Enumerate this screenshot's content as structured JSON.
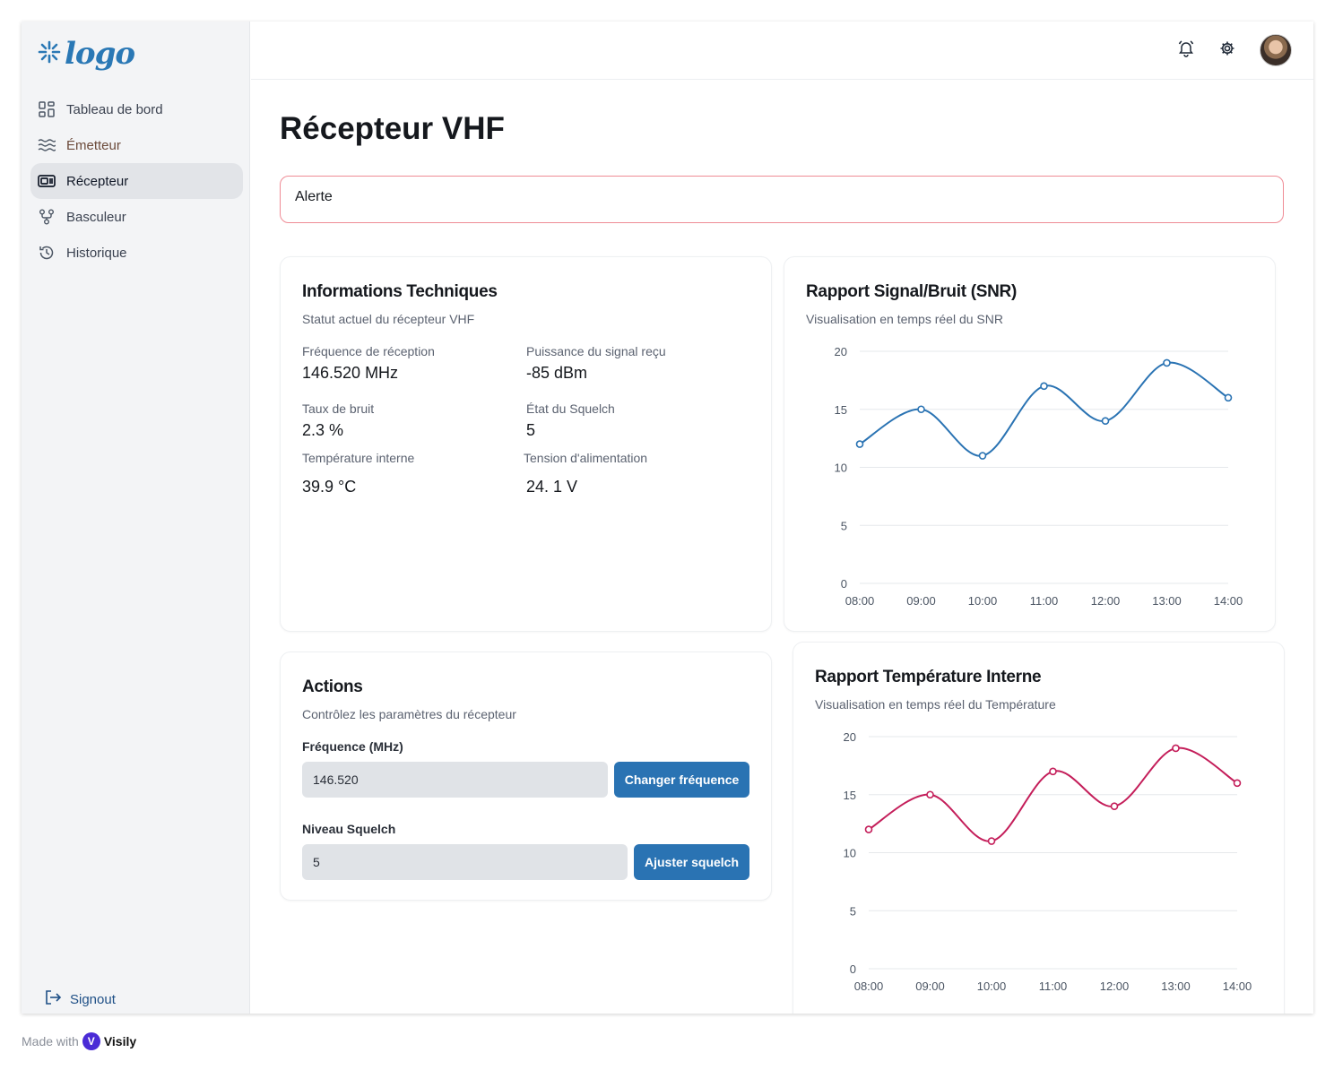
{
  "logo": {
    "text": "logo"
  },
  "sidebar": {
    "items": [
      {
        "label": "Tableau de bord",
        "icon": "dashboard-icon"
      },
      {
        "label": "Émetteur",
        "icon": "waves-icon"
      },
      {
        "label": "Récepteur",
        "icon": "receiver-icon",
        "active": true
      },
      {
        "label": "Basculeur",
        "icon": "switch-icon"
      },
      {
        "label": "Historique",
        "icon": "history-icon"
      }
    ],
    "signout": "Signout"
  },
  "header": {
    "icons": [
      "bell-icon",
      "gear-icon",
      "avatar"
    ]
  },
  "page": {
    "title": "Récepteur VHF",
    "alert": "Alerte"
  },
  "info": {
    "title": "Informations Techniques",
    "subtitle": "Statut actuel du récepteur VHF",
    "items": [
      {
        "label": "Fréquence de réception",
        "value": "146.520 MHz"
      },
      {
        "label": "Puissance du signal reçu",
        "value": "-85 dBm"
      },
      {
        "label": "Taux de bruit",
        "value": "2.3 %"
      },
      {
        "label": "État du Squelch",
        "value": "5"
      },
      {
        "label": "Température interne",
        "value": "39.9 °C"
      },
      {
        "label": "Tension d'alimentation",
        "value": "24. 1 V"
      }
    ]
  },
  "actions": {
    "title": "Actions",
    "subtitle": "Contrôlez les paramètres du récepteur",
    "freq_label": "Fréquence (MHz)",
    "freq_value": "146.520",
    "freq_button": "Changer fréquence",
    "squelch_label": "Niveau Squelch",
    "squelch_value": "5",
    "squelch_button": "Ajuster squelch"
  },
  "chart_data": [
    {
      "type": "line",
      "title": "Rapport Signal/Bruit (SNR)",
      "subtitle": "Visualisation en temps réel du SNR",
      "x": [
        "08:00",
        "09:00",
        "10:00",
        "11:00",
        "12:00",
        "13:00",
        "14:00"
      ],
      "series": [
        {
          "values": [
            12,
            15,
            11,
            17,
            14,
            19,
            16
          ]
        }
      ],
      "ylim": [
        0,
        20
      ],
      "yticks": [
        0,
        5,
        10,
        15,
        20
      ],
      "grid": true,
      "color": "#2a73b3"
    },
    {
      "type": "line",
      "title": "Rapport Température Interne",
      "subtitle": "Visualisation en temps réel du Température",
      "x": [
        "08:00",
        "09:00",
        "10:00",
        "11:00",
        "12:00",
        "13:00",
        "14:00"
      ],
      "series": [
        {
          "values": [
            12,
            15,
            11,
            17,
            14,
            19,
            16
          ]
        }
      ],
      "ylim": [
        0,
        20
      ],
      "yticks": [
        0,
        5,
        10,
        15,
        20
      ],
      "grid": true,
      "color": "#c41e5a"
    }
  ],
  "footer": {
    "made_with": "Made with",
    "brand": "Visily",
    "badge": "V"
  }
}
